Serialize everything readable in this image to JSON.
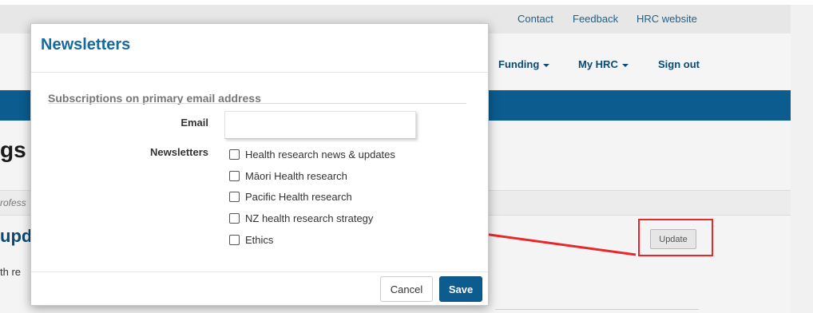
{
  "header": {
    "util_links": [
      "Contact",
      "Feedback",
      "HRC website"
    ],
    "nav": {
      "funding": "Funding",
      "my_hrc": "My HRC",
      "sign_out": "Sign out"
    }
  },
  "background": {
    "page_heading_fragment": "gs",
    "profile_tab_fragment": "rofess",
    "section_heading_fragment": "upd",
    "section_text_fragment": "th re",
    "update_button": "Update"
  },
  "modal": {
    "title": "Newsletters",
    "section_heading": "Subscriptions on primary email address",
    "email_label": "Email",
    "email_value": "",
    "newsletters_label": "Newsletters",
    "options": [
      {
        "label": "Health research news & updates",
        "checked": false
      },
      {
        "label": "Māori Health research",
        "checked": false
      },
      {
        "label": "Pacific Health research",
        "checked": false
      },
      {
        "label": "NZ health research strategy",
        "checked": false
      },
      {
        "label": "Ethics",
        "checked": false
      }
    ],
    "cancel_label": "Cancel",
    "save_label": "Save"
  },
  "colors": {
    "brand_blue": "#0c5c8f",
    "title_blue": "#17699e",
    "annotation_red": "#e8272b"
  }
}
